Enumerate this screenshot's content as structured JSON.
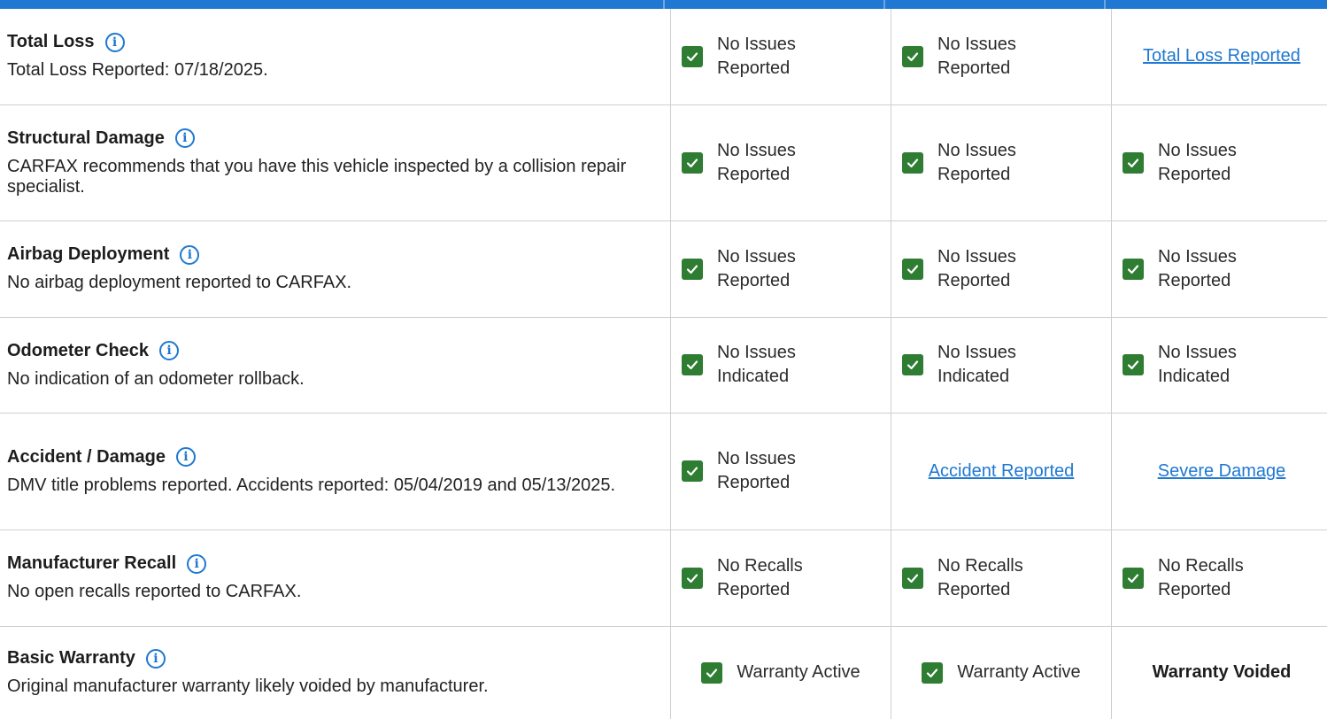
{
  "colors": {
    "accent": "#1f78d1",
    "check": "#2e7d32"
  },
  "rows": [
    {
      "title": "Total Loss",
      "desc": "Total Loss Reported: 07/18/2025.",
      "cols": [
        {
          "type": "check",
          "l1": "No Issues",
          "l2": "Reported"
        },
        {
          "type": "check",
          "l1": "No Issues",
          "l2": "Reported"
        },
        {
          "type": "link",
          "text": "Total Loss Reported"
        }
      ]
    },
    {
      "title": "Structural Damage",
      "desc": "CARFAX recommends that you have this vehicle inspected by a collision repair specialist.",
      "cols": [
        {
          "type": "check",
          "l1": "No Issues",
          "l2": "Reported"
        },
        {
          "type": "check",
          "l1": "No Issues",
          "l2": "Reported"
        },
        {
          "type": "check",
          "l1": "No Issues",
          "l2": "Reported"
        }
      ]
    },
    {
      "title": "Airbag Deployment",
      "desc": "No airbag deployment reported to CARFAX.",
      "cols": [
        {
          "type": "check",
          "l1": "No Issues",
          "l2": "Reported"
        },
        {
          "type": "check",
          "l1": "No Issues",
          "l2": "Reported"
        },
        {
          "type": "check",
          "l1": "No Issues",
          "l2": "Reported"
        }
      ]
    },
    {
      "title": "Odometer Check",
      "desc": "No indication of an odometer rollback.",
      "cols": [
        {
          "type": "check",
          "l1": "No Issues",
          "l2": "Indicated"
        },
        {
          "type": "check",
          "l1": "No Issues",
          "l2": "Indicated"
        },
        {
          "type": "check",
          "l1": "No Issues",
          "l2": "Indicated"
        }
      ]
    },
    {
      "title": "Accident / Damage",
      "desc": "DMV title problems reported. Accidents reported: 05/04/2019 and 05/13/2025.",
      "cols": [
        {
          "type": "check",
          "l1": "No Issues",
          "l2": "Reported"
        },
        {
          "type": "link",
          "text": "Accident Reported"
        },
        {
          "type": "link",
          "text": "Severe Damage"
        }
      ]
    },
    {
      "title": "Manufacturer Recall",
      "desc": "No open recalls reported to CARFAX.",
      "cols": [
        {
          "type": "check",
          "l1": "No Recalls",
          "l2": "Reported"
        },
        {
          "type": "check",
          "l1": "No Recalls",
          "l2": "Reported"
        },
        {
          "type": "check",
          "l1": "No Recalls",
          "l2": "Reported"
        }
      ]
    },
    {
      "title": "Basic Warranty",
      "desc": "Original manufacturer warranty likely voided by manufacturer.",
      "cols": [
        {
          "type": "check-single",
          "text": "Warranty Active"
        },
        {
          "type": "check-single",
          "text": "Warranty Active"
        },
        {
          "type": "bold",
          "text": "Warranty Voided"
        }
      ]
    }
  ]
}
